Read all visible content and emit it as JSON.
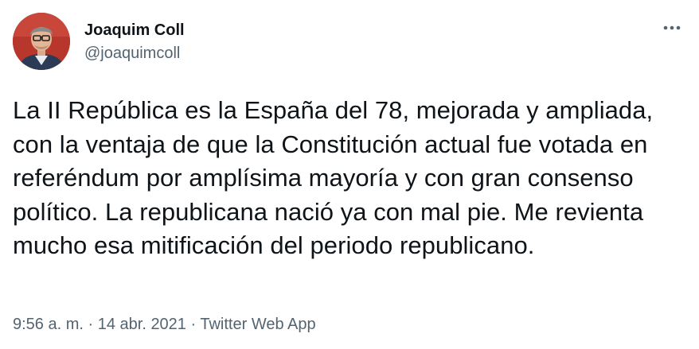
{
  "tweet": {
    "author": {
      "display_name": "Joaquim Coll",
      "handle": "@joaquimcoll"
    },
    "more_options_icon": "more-horizontal-icon",
    "text": "La II República es la España del 78, mejorada y ampliada, con la ventaja de que la Constitución actual fue votada en referéndum por amplísima mayoría y con gran consenso político. La republicana nació ya con mal pie. Me revienta mucho esa mitificación del periodo republicano.",
    "time": "9:56 a. m.",
    "separator": " · ",
    "date": "14 abr. 2021",
    "source": "Twitter Web App"
  },
  "colors": {
    "text_primary": "#0f1419",
    "text_secondary": "#536471",
    "avatar_background": "#b7372c"
  }
}
